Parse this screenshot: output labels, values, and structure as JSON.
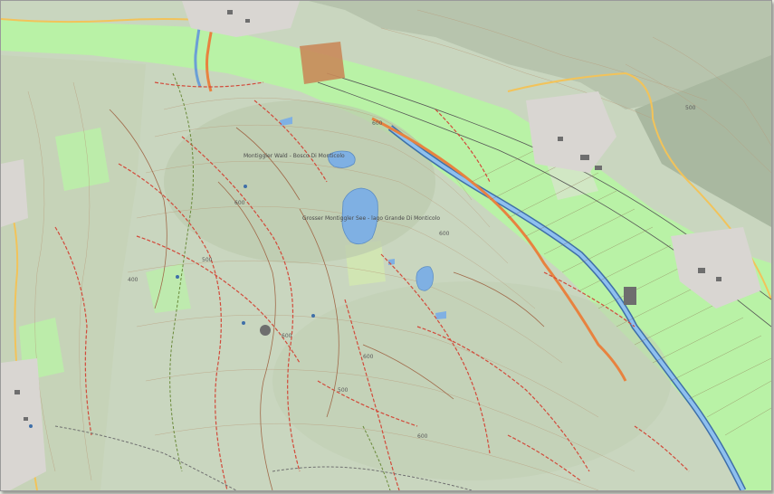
{
  "map": {
    "colors": {
      "terrain": "#c9d6bf",
      "terrain_dark": "#9fae97",
      "valley_green": "#b9f2a6",
      "water": "#7fb0e3",
      "river": "#6b9fd6",
      "river_edge": "#3f6fa8",
      "highway": "#e8823f",
      "main_road": "#f2c35a",
      "trail_red": "#d24a3a",
      "trail_brown": "#a06a4a",
      "contour": "#b89a7a",
      "settlement": "#d9d6d2",
      "building": "#6e6e6e",
      "rail": "#555555",
      "clay_field": "#c98a5a"
    },
    "place_labels": {
      "forest": "Montiggler Wald - Bosco Di Monticolo",
      "lake_big": "Grosser Montiggler See - lago Grande Di Monticolo"
    },
    "elevation_labels": {
      "e1": "600",
      "e2": "600",
      "e3": "600",
      "e4": "500",
      "e5": "600",
      "e6": "400",
      "e7": "600",
      "e8": "500",
      "e9": "600",
      "e10": "500"
    }
  }
}
